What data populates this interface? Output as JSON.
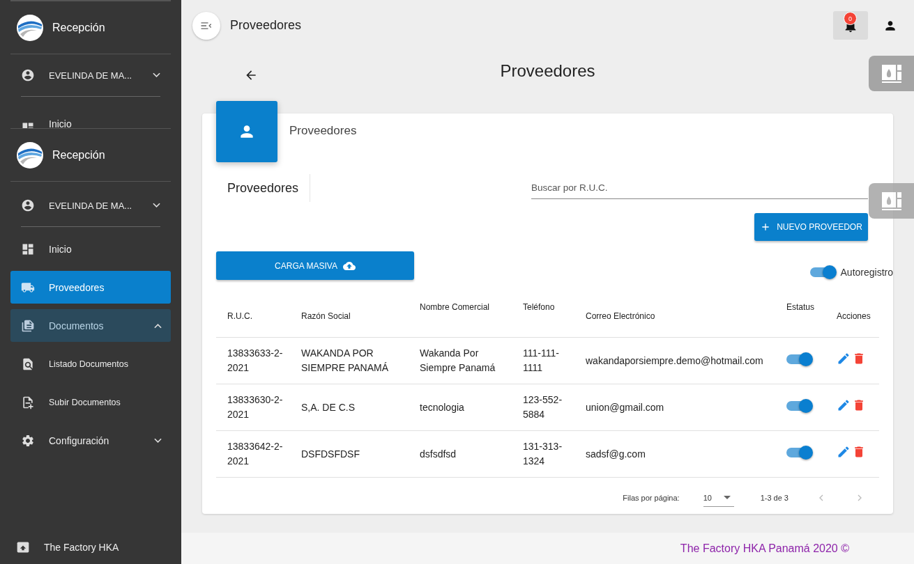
{
  "sidebar": {
    "ghost": {
      "brand": "Recepción",
      "user": "EVELINDA DE MA...",
      "item": "Inicio"
    },
    "brand": "Recepción",
    "user": {
      "name": "EVELINDA DE MA...",
      "expanded": false
    },
    "items": [
      {
        "label": "Inicio",
        "selected": false
      },
      {
        "label": "Proveedores",
        "selected": true
      },
      {
        "label": "Documentos",
        "selected": false,
        "expanded": true,
        "children": [
          {
            "label": "Listado Documentos"
          },
          {
            "label": "Subir Documentos"
          }
        ]
      },
      {
        "label": "Configuración",
        "selected": false,
        "expanded": false
      }
    ],
    "footer": "The Factory HKA"
  },
  "topbar": {
    "title": "Proveedores",
    "notifications": "0"
  },
  "page_title": "Proveedores",
  "card": {
    "title": "Proveedores",
    "section_title": "Proveedores",
    "search": {
      "placeholder": "Buscar por R.U.C."
    },
    "new_button": "NUEVO PROVEEDOR",
    "bulk_button": "CARGA MASIVA",
    "autoregistro": {
      "label": "Autoregistro",
      "on": true
    },
    "table": {
      "columns": [
        "R.U.C.",
        "Razón Social",
        "Nombre Comercial",
        "Teléfono",
        "Correo Electrónico",
        "Estatus",
        "Acciones"
      ],
      "rows": [
        {
          "ruc": "13833633-2-2021",
          "razon": "WAKANDA POR SIEMPRE PANAMÁ",
          "nombre": "Wakanda Por Siempre Panamá",
          "telefono": "111-111-1111",
          "correo": "wakandaporsiempre.demo@hotmail.com",
          "status_on": true
        },
        {
          "ruc": "13833630-2-2021",
          "razon": "S,A. DE C.S",
          "nombre": "tecnologia",
          "telefono": "123-552-5884",
          "correo": "union@gmail.com",
          "status_on": true
        },
        {
          "ruc": "13833642-2-2021",
          "razon": "DSFDSFDSF",
          "nombre": "dsfsdfsd",
          "telefono": "131-313-1324",
          "correo": "sadsf@g.com",
          "status_on": true
        }
      ]
    },
    "pagination": {
      "rows_label": "Filas por página:",
      "rows_value": "10",
      "range": "1-3 de 3",
      "prev_disabled": true,
      "next_disabled": true
    }
  },
  "footer": "The Factory HKA Panamá 2020 ©"
}
